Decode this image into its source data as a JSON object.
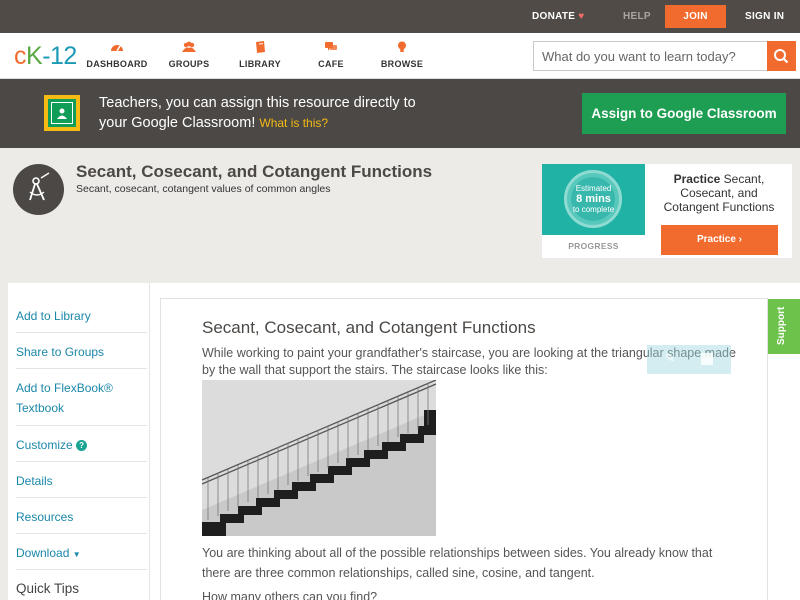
{
  "topbar": {
    "donate": "DONATE",
    "help": "HELP",
    "join": "JOIN",
    "signin": "SIGN IN"
  },
  "nav": {
    "logo": {
      "c": "c",
      "k": "K",
      "rest": "-12"
    },
    "items": [
      {
        "label": "DASHBOARD",
        "icon": "dashboard-gauge-icon",
        "color": "#f26b2e"
      },
      {
        "label": "GROUPS",
        "icon": "groups-people-icon",
        "color": "#f26b2e"
      },
      {
        "label": "LIBRARY",
        "icon": "library-book-icon",
        "color": "#f26b2e"
      },
      {
        "label": "CAFE",
        "icon": "cafe-chat-icon",
        "color": "#f26b2e"
      },
      {
        "label": "BROWSE",
        "icon": "browse-lightbulb-icon",
        "color": "#f26b2e"
      }
    ],
    "search_placeholder": "What do you want to learn today?"
  },
  "banner": {
    "line1": "Teachers, you can assign this resource directly to",
    "line2": "your Google Classroom!",
    "what": "What is this?",
    "assign_button": "Assign to Google Classroom"
  },
  "header": {
    "title": "Secant, Cosecant, and Cotangent Functions",
    "subtitle": "Secant, cosecant, cotangent values of common angles"
  },
  "practice": {
    "estimated": "Estimated",
    "mins": "8 mins",
    "to_complete": "to complete",
    "progress_label": "PROGRESS",
    "title_bold": "Practice",
    "title_rest": "Secant, Cosecant, and Cotangent Functions",
    "button": "Practice"
  },
  "sidebar": {
    "items": [
      {
        "label": "Add to Library"
      },
      {
        "label": "Share to Groups"
      },
      {
        "label": "Add to FlexBook® Textbook"
      },
      {
        "label": "Customize"
      },
      {
        "label": "Details"
      },
      {
        "label": "Resources"
      },
      {
        "label": "Download"
      }
    ],
    "quick_tips": "Quick Tips"
  },
  "article": {
    "title": "Secant, Cosecant, and Cotangent Functions",
    "para1": "While working to paint your grandfather's staircase, you are looking at the triangular shape made by the wall that support the stairs. The staircase looks like this:",
    "para2": "You are thinking about all of the possible relationships between sides. You already know that there are three common relationships, called sine, cosine, and tangent.",
    "para3": "How many others can you find?"
  },
  "support_tab": "Support",
  "colors": {
    "accent_orange": "#f26b2e",
    "classroom_green": "#1e9e52",
    "link_blue": "#1b87a8",
    "support_green": "#6cc24a"
  }
}
